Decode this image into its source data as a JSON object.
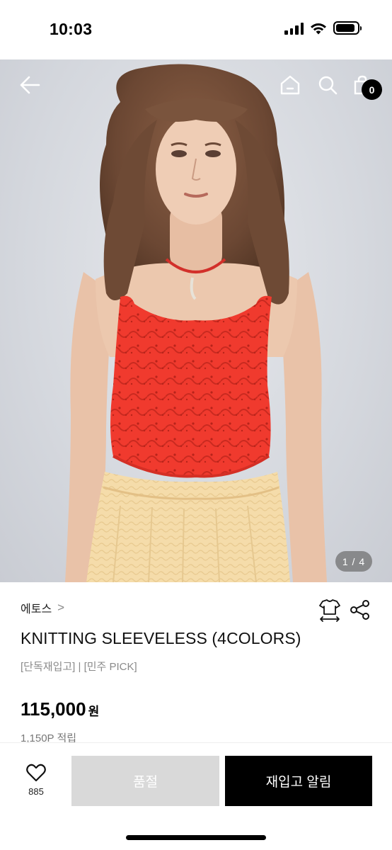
{
  "status_bar": {
    "time": "10:03",
    "icons": [
      "signal-icon",
      "wifi-icon",
      "battery-icon"
    ]
  },
  "header": {
    "icons": [
      "back-arrow-icon",
      "home-icon",
      "search-icon",
      "shopping-bag-icon"
    ],
    "cart_count": "0"
  },
  "gallery": {
    "page_indicator": "1 / 4",
    "current": 1,
    "total": 4
  },
  "product": {
    "brand": "에토스",
    "brand_chevron": ">",
    "name": "KNITTING SLEEVELESS (4COLORS)",
    "tags": "[단독재입고] | [민주 PICK]",
    "price": "115,000",
    "currency": "원",
    "points": "1,150P 적립",
    "action_icons": [
      "size-guide-icon",
      "share-icon"
    ]
  },
  "bottom_bar": {
    "like_count": "885",
    "soldout_label": "품절",
    "restock_label": "재입고 알림",
    "icons": [
      "heart-icon"
    ]
  },
  "colors": {
    "top_red": "#f03a2e",
    "skirt_yellow": "#f5dcaa",
    "soldout_gray": "#d9d9d9",
    "primary_black": "#000000"
  }
}
